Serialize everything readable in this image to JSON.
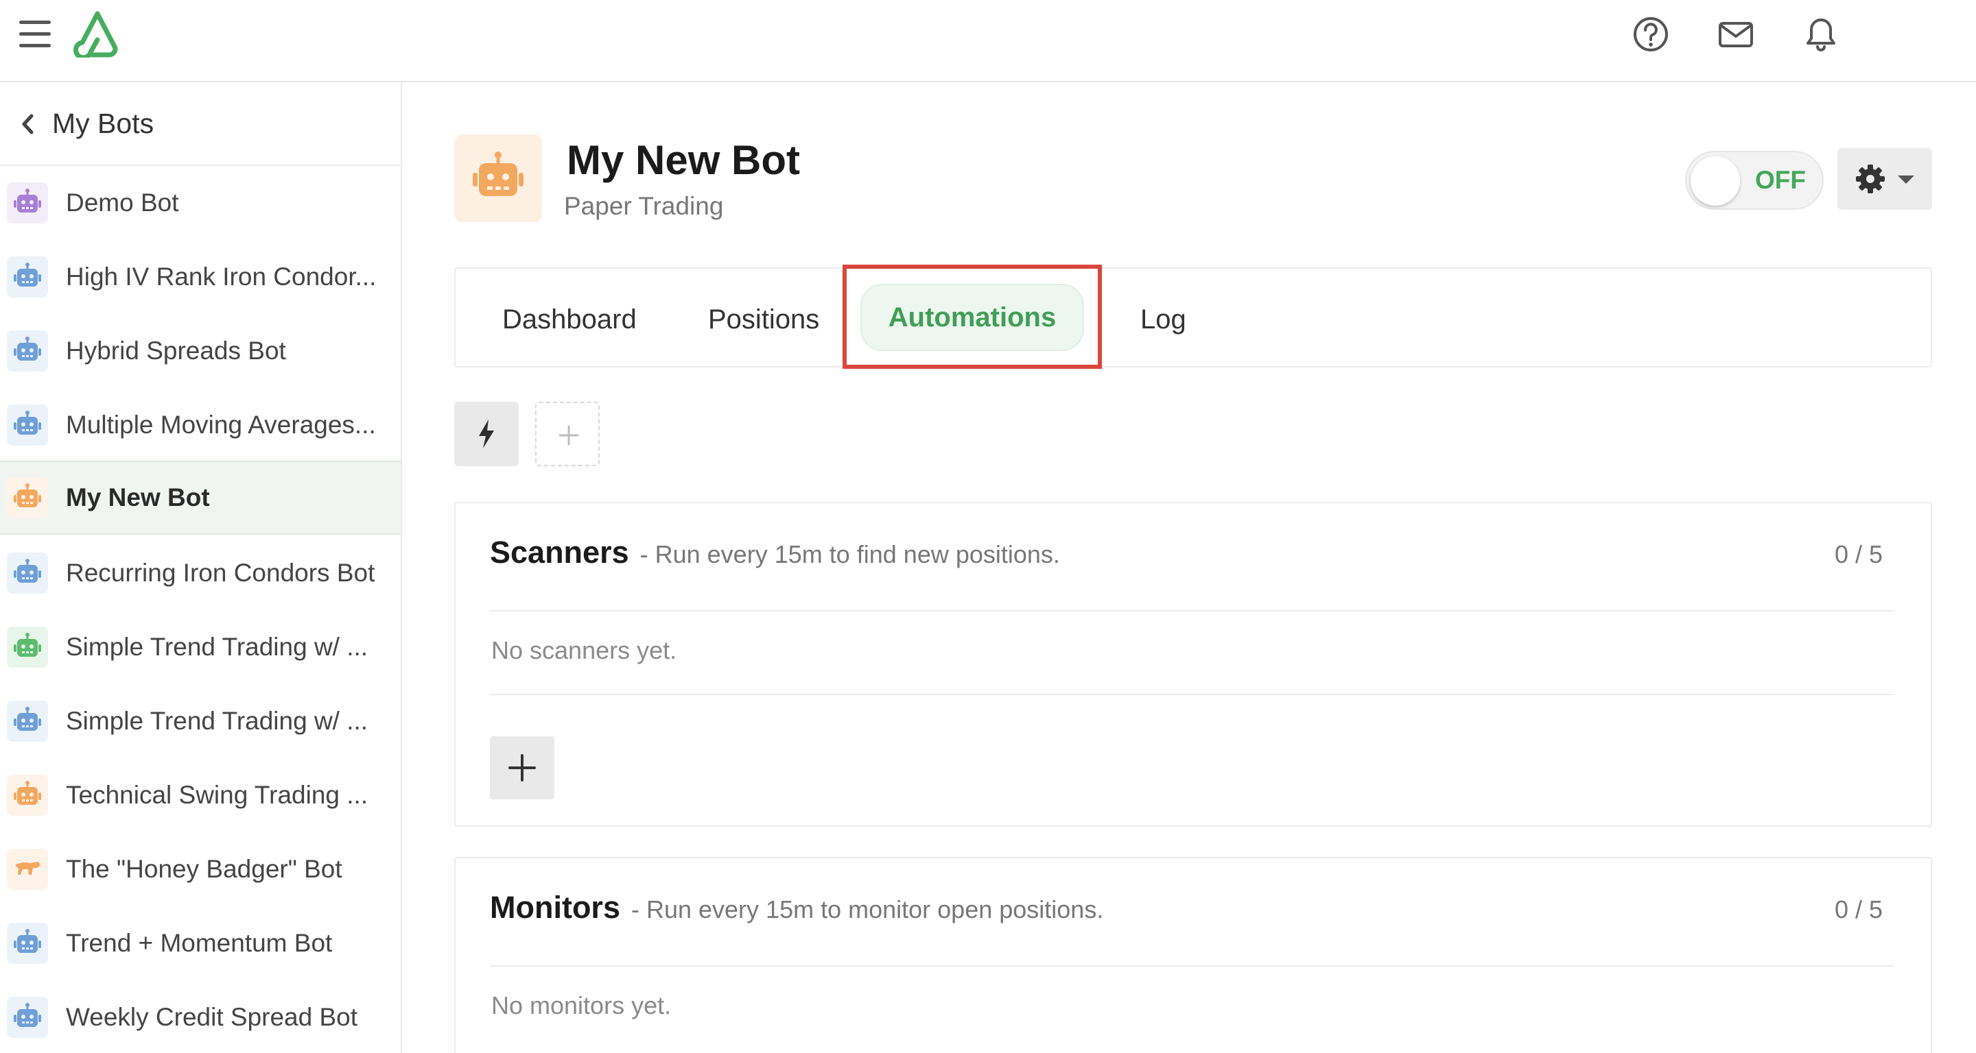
{
  "sidebar": {
    "back_label": "My Bots",
    "bots": [
      {
        "label": "Demo Bot",
        "color": "#a77fd6"
      },
      {
        "label": "High IV Rank Iron Condor...",
        "color": "#6f9fd6"
      },
      {
        "label": "Hybrid Spreads Bot",
        "color": "#6f9fd6"
      },
      {
        "label": "Multiple Moving Averages...",
        "color": "#6f9fd6"
      },
      {
        "label": "My New Bot",
        "color": "#f3a85f",
        "active": true
      },
      {
        "label": "Recurring Iron Condors Bot",
        "color": "#6f9fd6"
      },
      {
        "label": "Simple Trend Trading w/ ...",
        "color": "#5dbb6e"
      },
      {
        "label": "Simple Trend Trading w/ ...",
        "color": "#6f9fd6"
      },
      {
        "label": "Technical Swing Trading ...",
        "color": "#f3a85f"
      },
      {
        "label": "The \"Honey Badger\" Bot",
        "color": "#f3a85f"
      },
      {
        "label": "Trend + Momentum Bot",
        "color": "#6f9fd6"
      },
      {
        "label": "Weekly Credit Spread Bot",
        "color": "#6f9fd6"
      }
    ]
  },
  "bot": {
    "title": "My New Bot",
    "subtitle": "Paper Trading",
    "toggle_label": "OFF"
  },
  "tabs": [
    {
      "label": "Dashboard"
    },
    {
      "label": "Positions"
    },
    {
      "label": "Automations",
      "active": true
    },
    {
      "label": "Log"
    }
  ],
  "scanners": {
    "name": "Scanners",
    "desc": "- Run every 15m to find new positions.",
    "count": "0 / 5",
    "empty": "No scanners yet."
  },
  "monitors": {
    "name": "Monitors",
    "desc": "- Run every 15m to monitor open positions.",
    "count": "0 / 5",
    "empty": "No monitors yet."
  },
  "colors": {
    "brand_green": "#43a75b",
    "highlight_red": "#d9473c",
    "bot_orange": "#f3a85f",
    "bot_blue": "#6f9fd6",
    "bot_purple": "#a77fd6"
  }
}
